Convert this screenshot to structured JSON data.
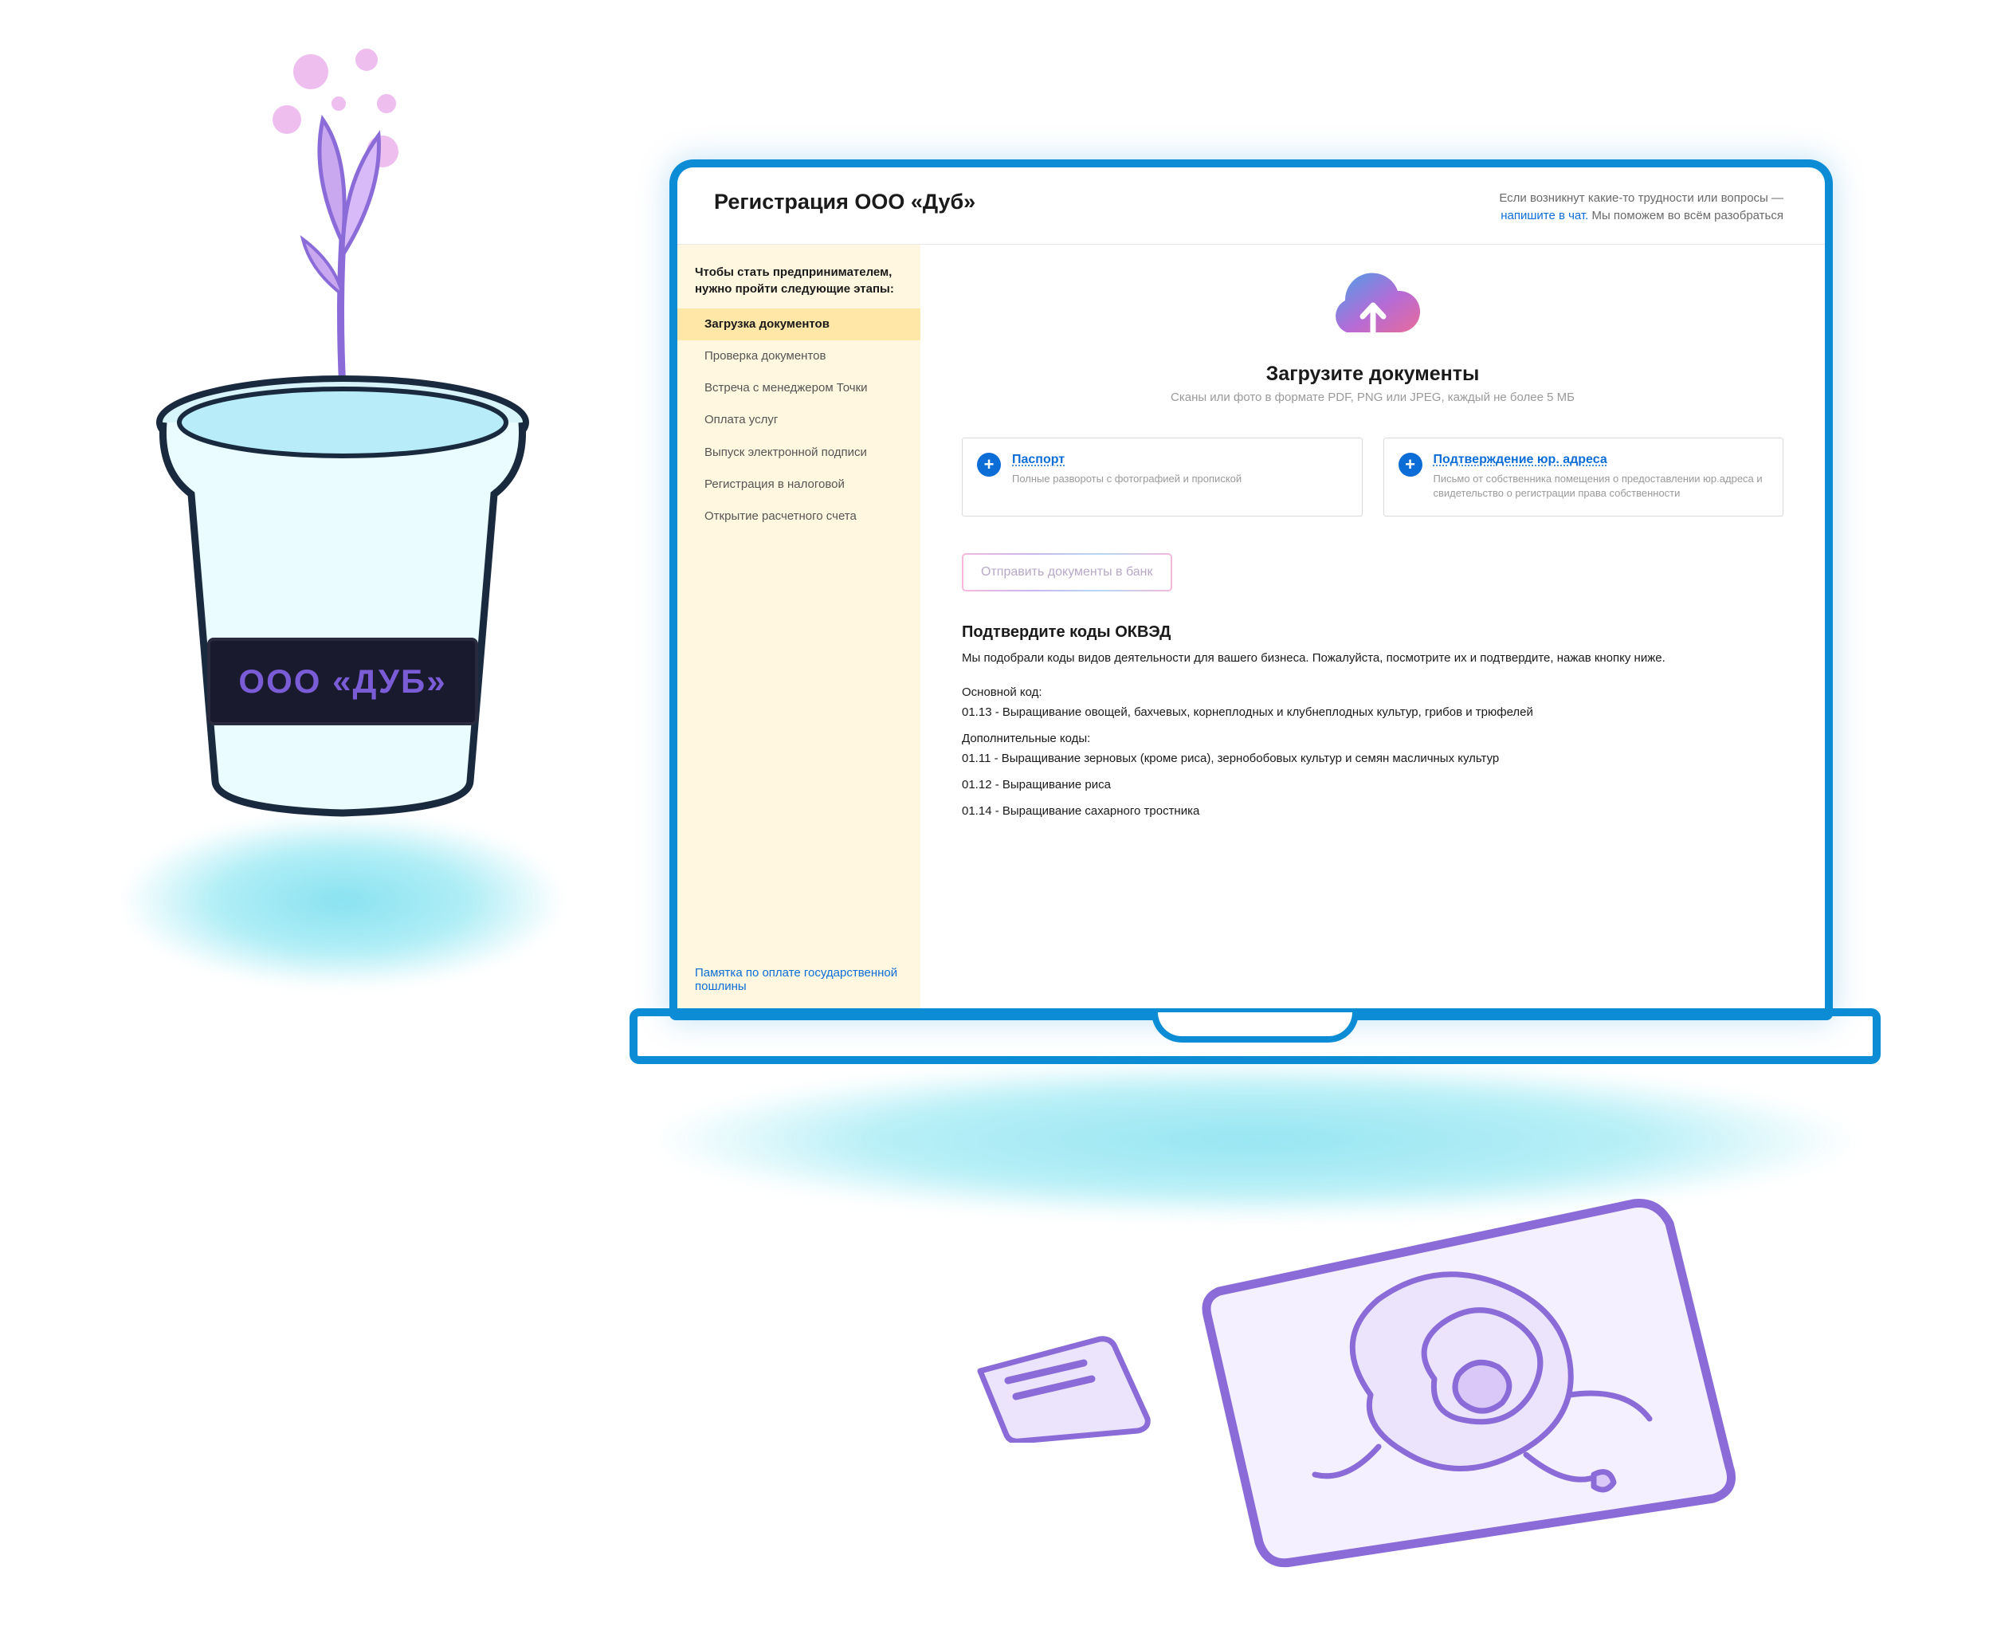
{
  "illustration": {
    "pot_label": "ООО «ДУБ»"
  },
  "header": {
    "title": "Регистрация ООО «Дуб»",
    "help_prefix": "Если возникнут какие-то трудности или вопросы —",
    "help_link": "напишите в чат.",
    "help_suffix": "Мы поможем во всём разобраться"
  },
  "sidebar": {
    "heading": "Чтобы стать предпринимателем, нужно пройти следующие этапы:",
    "items": [
      {
        "label": "Загрузка документов",
        "active": true
      },
      {
        "label": "Проверка документов",
        "active": false
      },
      {
        "label": "Встреча с менеджером Точки",
        "active": false
      },
      {
        "label": "Оплата услуг",
        "active": false
      },
      {
        "label": "Выпуск электронной подписи",
        "active": false
      },
      {
        "label": "Регистрация в налоговой",
        "active": false
      },
      {
        "label": "Открытие расчетного счета",
        "active": false
      }
    ],
    "footer_link": "Памятка по оплате государственной пошлины"
  },
  "upload": {
    "title": "Загрузите документы",
    "subtitle": "Сканы или фото в формате PDF, PNG или JPEG, каждый не более 5 МБ"
  },
  "doc_cards": [
    {
      "title": "Паспорт",
      "desc": "Полные развороты с фотографией и пропиской"
    },
    {
      "title": "Подтверждение юр. адреса",
      "desc": "Письмо от собственника помещения о предоставлении юр.адреса и свидетельство о регистрации права собственности"
    }
  ],
  "submit_label": "Отправить документы в банк",
  "okved": {
    "title": "Подтвердите коды ОКВЭД",
    "intro": "Мы подобрали коды видов деятельности для вашего бизнеса. Пожалуйста, посмотрите их и подтвердите, нажав кнопку ниже.",
    "main_label": "Основной код:",
    "main_code": "01.13 - Выращивание овощей, бахчевых, корнеплодных и клубнеплодных культур, грибов и трюфелей",
    "extra_label": "Дополнительные коды:",
    "extra_codes": [
      "01.11 - Выращивание зерновых (кроме риса), зернобобовых культур и семян масличных культур",
      "01.12 - Выращивание риса",
      "01.14 - Выращивание сахарного тростника"
    ]
  }
}
